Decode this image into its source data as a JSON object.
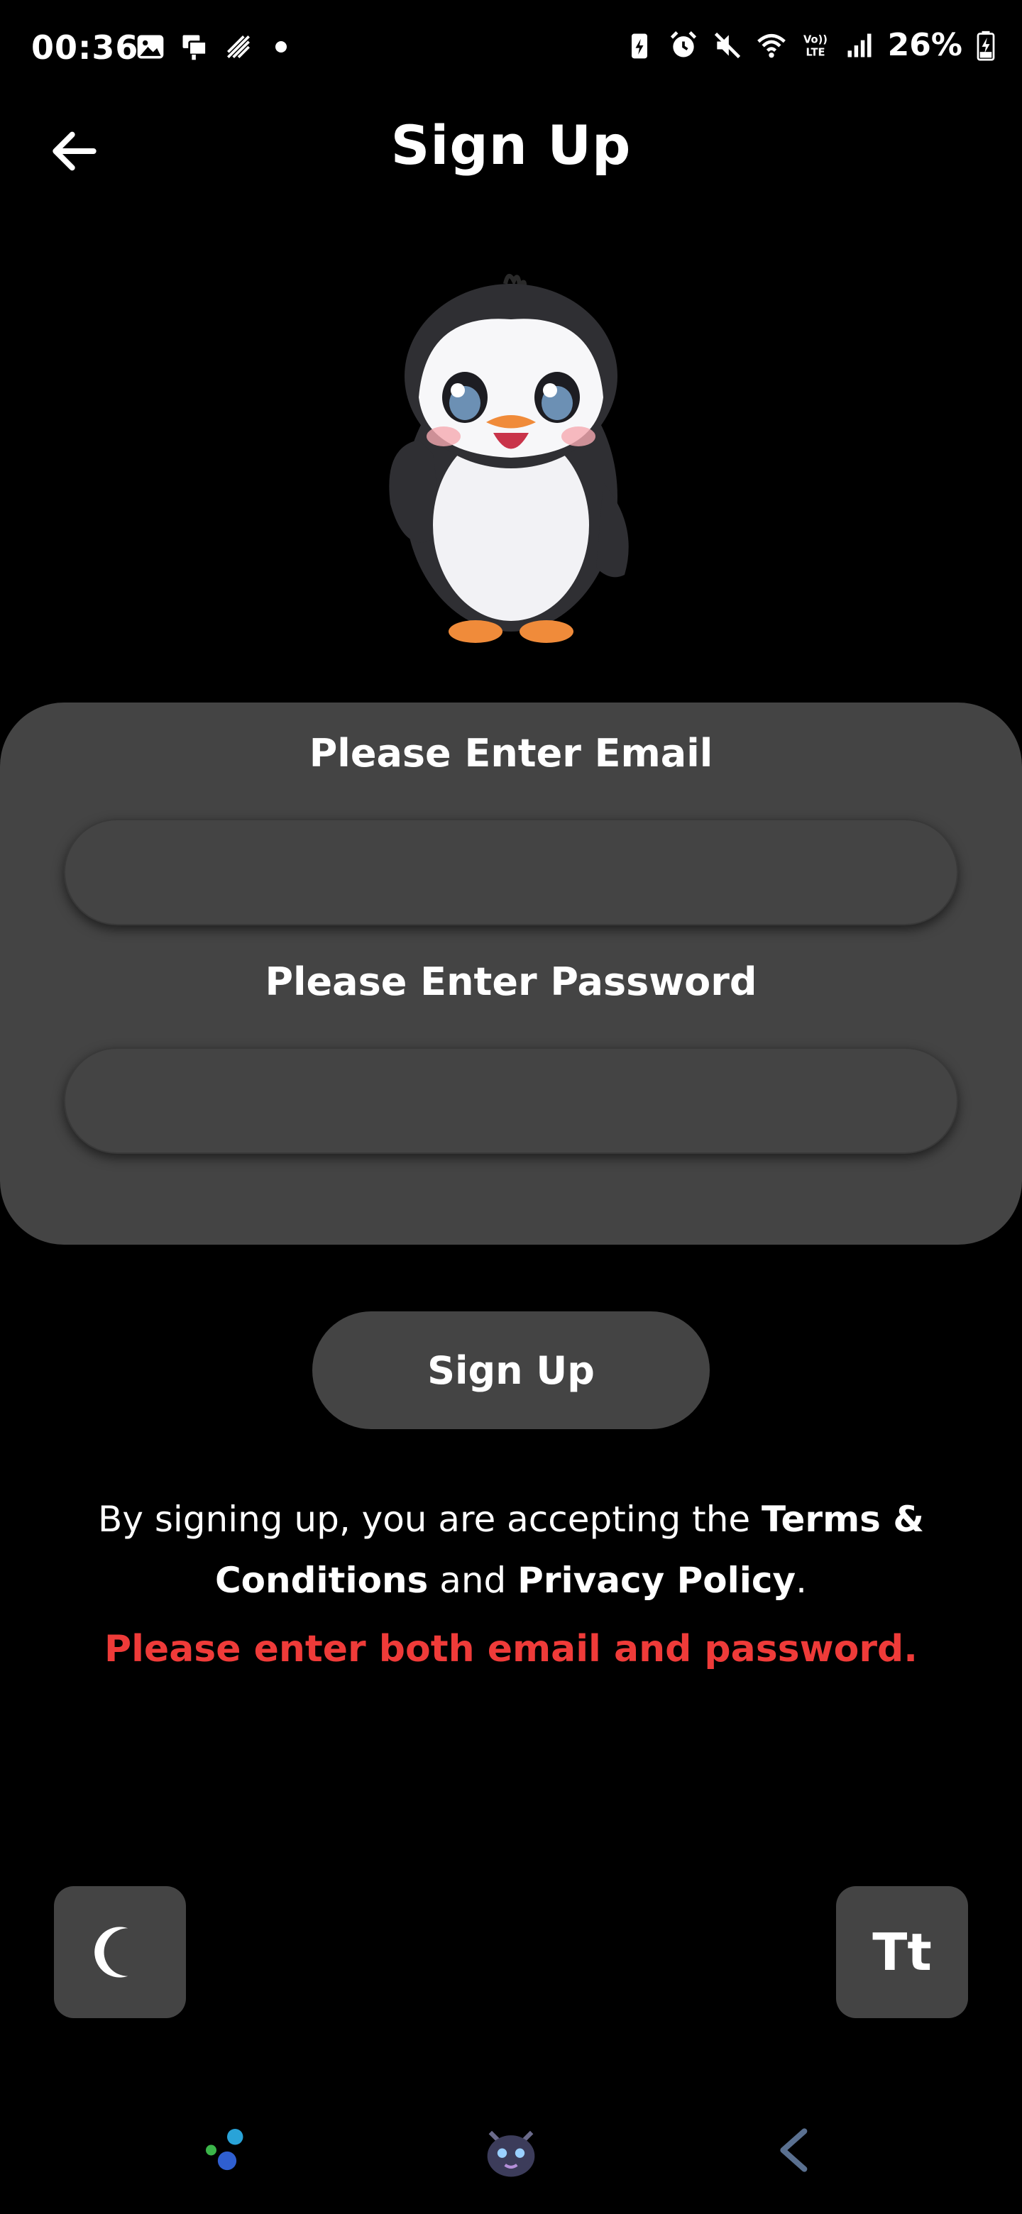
{
  "status_bar": {
    "time": "00:36",
    "battery": "26%"
  },
  "header": {
    "title": "Sign Up",
    "back_icon": "arrow-left-icon"
  },
  "form": {
    "email_label": "Please Enter Email",
    "email_value": "",
    "password_label": "Please Enter Password",
    "password_value": ""
  },
  "signup_button": {
    "label": "Sign Up"
  },
  "terms": {
    "prefix": "By signing up, you are accepting the ",
    "terms_link": "Terms & Conditions",
    "middle": " and ",
    "privacy_link": "Privacy Policy",
    "suffix": "."
  },
  "error": {
    "message": "Please enter both email and password."
  },
  "toggles": {
    "theme_icon": "moon-icon",
    "font_label": "Tt"
  },
  "colors": {
    "background": "#000000",
    "surface": "#444444",
    "error": "#ef3b39",
    "text": "#ffffff"
  }
}
